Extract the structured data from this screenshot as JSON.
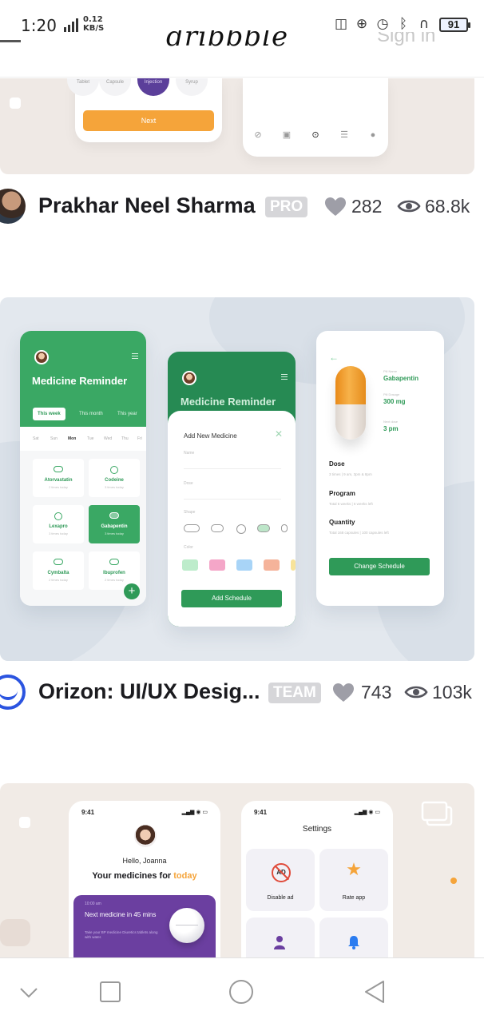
{
  "status_bar": {
    "time": "1:20",
    "net_speed_value": "0.12",
    "net_speed_unit": "KB/S",
    "battery": "91",
    "icons": [
      "vibrate-icon",
      "lock-rotation-icon",
      "alarm-icon",
      "bluetooth-icon",
      "headset-icon"
    ]
  },
  "header": {
    "logo_text": "dribbble",
    "signin_label": "Sign in"
  },
  "shot1": {
    "next_label": "Next",
    "chips": [
      "Tablet",
      "Capsule",
      "Injection",
      "Syrup"
    ]
  },
  "shots": [
    {
      "author": "Prakhar Neel Sharma",
      "badge": "PRO",
      "likes": "282",
      "views": "68.8k"
    },
    {
      "author": "Orizon: UI/UX Desig...",
      "badge": "TEAM",
      "likes": "743",
      "views": "103k"
    }
  ],
  "shot2": {
    "app_title": "Medicine Reminder",
    "segments": [
      "This week",
      "This month",
      "This year"
    ],
    "days": [
      "Sat",
      "Sun",
      "Mon",
      "Tue",
      "Wed",
      "Thu",
      "Fri"
    ],
    "medicines": [
      {
        "name": "Atorvastatin",
        "sub": "2 times today"
      },
      {
        "name": "Codeine",
        "sub": "3 times today"
      },
      {
        "name": "Lexapro",
        "sub": "3 times today"
      },
      {
        "name": "Gabapentin",
        "sub": "3 times today"
      },
      {
        "name": "Cymbalta",
        "sub": "2 times today"
      },
      {
        "name": "Ibuprofen",
        "sub": "2 times today"
      }
    ],
    "sheet_title": "Add New Medicine",
    "field_name": "Name",
    "field_dose": "Dose",
    "field_shape": "Shape",
    "field_color": "Color",
    "add_schedule": "Add Schedule",
    "pill_name_label": "Pill Name",
    "pill_name": "Gabapentin",
    "pill_dosage_label": "Pill Dosage",
    "pill_dosage": "300 mg",
    "next_dose_label": "Next dose",
    "next_dose": "3 pm",
    "dose_h": "Dose",
    "dose_s": "3 times  |  9 am, 3pm & 8pm",
    "program_h": "Program",
    "program_s": "Total 6 weeks  |  6 weeks left",
    "quantity_h": "Quantity",
    "quantity_s": "Total 168 capsules  |  100 capsules left",
    "change_schedule": "Change Schedule",
    "swatch_colors": [
      "#bdeccb",
      "#f4a6c8",
      "#a8d4f7",
      "#f5b39a",
      "#f7e39a"
    ]
  },
  "shot3": {
    "time": "9:41",
    "hello": "Hello, Joanna",
    "your_meds": "Your medicines for",
    "today": "today",
    "card_time": "10:00 am",
    "next_med": "Next medicine in 45 mins",
    "card_sub": "Take your BP medicine Diuretics tablets along with water.",
    "settings_title": "Settings",
    "disable_ad": "Disable ad",
    "rate_app": "Rate app",
    "ad_text": "AD"
  },
  "colors": {
    "green": "#3aa864",
    "dark_green": "#2f9a58",
    "orange": "#f5a43a",
    "purple": "#6b3fa0",
    "badge_grey": "#d6d6d9"
  }
}
